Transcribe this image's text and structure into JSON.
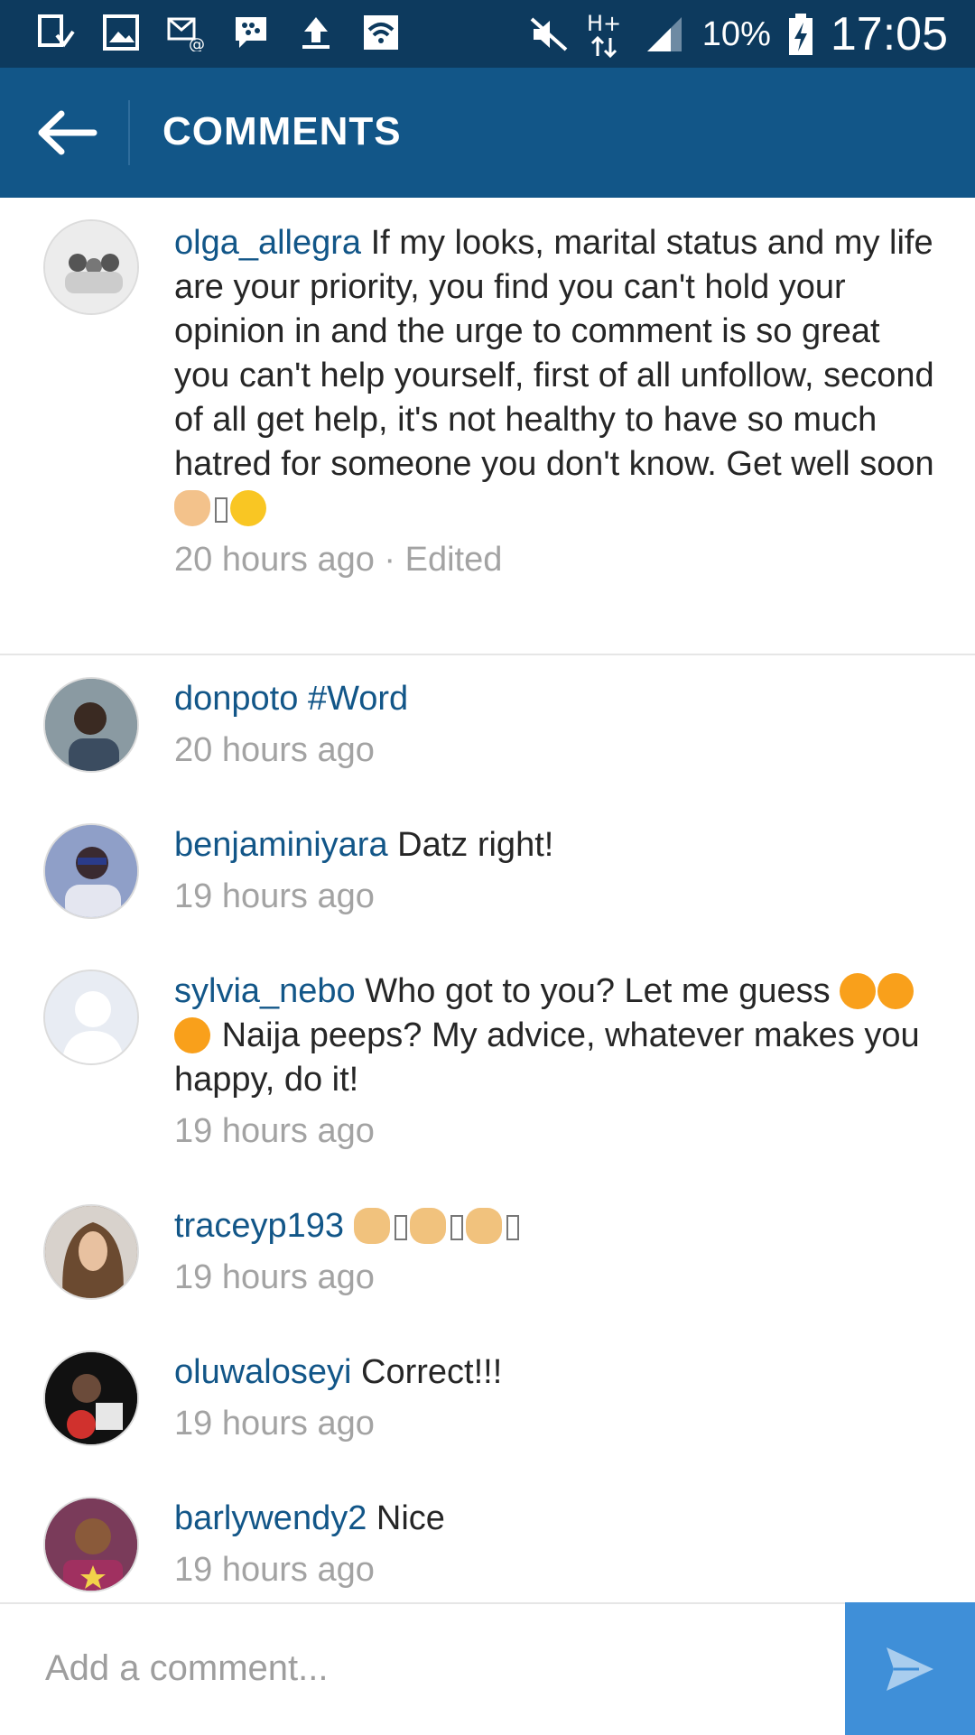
{
  "status_bar": {
    "battery": "10%",
    "time": "17:05",
    "network": "H+"
  },
  "app_bar": {
    "title": "COMMENTS"
  },
  "comments": [
    {
      "user": "olga_allegra",
      "text": "If my looks, marital status and my life are your priority, you find you can't hold your opinion in and the urge to comment is so great you can't help yourself, first of all unfollow, second of all get help, it's not healthy to have so much hatred for someone you don't know. Get well soon",
      "time": "20 hours ago",
      "edited": " · Edited"
    },
    {
      "user": "donpoto",
      "text": "#Word",
      "time": "20 hours ago"
    },
    {
      "user": "benjaminiyara",
      "text": "Datz right!",
      "time": "19 hours ago"
    },
    {
      "user": "sylvia_nebo",
      "text_a": "Who got to you? Let me guess",
      "text_b": "Naija peeps? My advice, whatever makes you happy, do it!",
      "time": "19 hours ago"
    },
    {
      "user": "traceyp193",
      "text": "",
      "time": "19 hours ago"
    },
    {
      "user": "oluwaloseyi",
      "text": "Correct!!!",
      "time": "19 hours ago"
    },
    {
      "user": "barlywendy2",
      "text": "Nice",
      "time": "19 hours ago"
    }
  ],
  "input": {
    "placeholder": "Add a comment..."
  },
  "colors": {
    "status_bar": "#0d3a5e",
    "app_bar": "#125688",
    "username": "#125688",
    "send_button": "#3f8fd8"
  }
}
